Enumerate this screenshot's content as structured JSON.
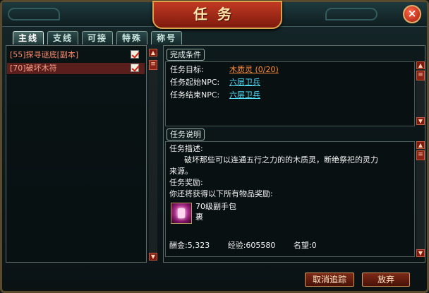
{
  "window": {
    "title": "任务"
  },
  "tabs": [
    "主线",
    "支线",
    "可接",
    "特殊",
    "称号"
  ],
  "quest_list": [
    {
      "label": "[55]探寻谜底[副本]",
      "checked": true
    },
    {
      "label": "[70]破坏木符",
      "checked": true
    }
  ],
  "completion": {
    "header": "完成条件",
    "target_label": "任务目标:",
    "target_value": "木质灵 (0/20)",
    "start_npc_label": "任务起始NPC:",
    "start_npc_value": "六层卫兵",
    "end_npc_label": "任务结束NPC:",
    "end_npc_value": "六层卫兵"
  },
  "description": {
    "header": "任务说明",
    "desc_label": "任务描述:",
    "desc_line1": "破坏那些可以连通五行之力的的木质灵，断绝祭祀的灵力",
    "desc_line2": "来源。",
    "reward_label": "任务奖励:",
    "reward_intro": "你还将获得以下所有物品奖励:",
    "item_name": "70级副手包裹",
    "rewards": {
      "money": "酬金:5,323",
      "exp": "经验:605580",
      "fame": "名望:0"
    }
  },
  "buttons": {
    "cancel_track": "取消追踪",
    "abandon": "放弃"
  },
  "colors": {
    "accent": "#c23a22",
    "target": "#ff8c3a",
    "npc_link": "#52e2ff",
    "quest_text": "#ff8a6a"
  }
}
